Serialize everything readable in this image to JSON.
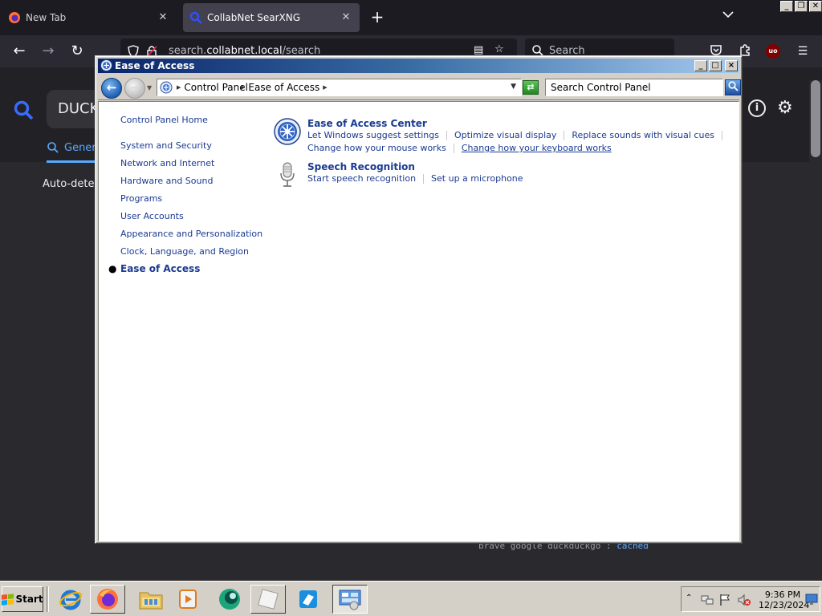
{
  "firefox": {
    "tabs": [
      {
        "label": "New Tab",
        "active": false
      },
      {
        "label": "CollabNet SearXNG",
        "active": true
      }
    ],
    "url_prefix": "search.",
    "url_host": "collabnet.local",
    "url_path": "/search",
    "search_placeholder": "Search",
    "ublock_badge": "uo"
  },
  "searxng": {
    "query": "DUCK",
    "tab_label": "Genera",
    "autodetect_text": "Auto-detect",
    "engines_text": "brave  google  duckduckgo  : ",
    "cached_label": "cached"
  },
  "window": {
    "title": "Ease of Access",
    "breadcrumb": [
      "Control Panel",
      "Ease of Access"
    ],
    "search_placeholder": "Search Control Panel",
    "title_buttons": [
      "_",
      "□",
      "×"
    ]
  },
  "left_nav": {
    "items": [
      {
        "label": "Control Panel Home"
      },
      {
        "label": "System and Security"
      },
      {
        "label": "Network and Internet"
      },
      {
        "label": "Hardware and Sound"
      },
      {
        "label": "Programs"
      },
      {
        "label": "User Accounts"
      },
      {
        "label": "Appearance and Personalization"
      },
      {
        "label": "Clock, Language, and Region"
      },
      {
        "label": "Ease of Access",
        "current": true
      }
    ]
  },
  "categories": [
    {
      "title": "Ease of Access Center",
      "icon": "ease-of-access-icon",
      "links_row1": [
        "Let Windows suggest settings",
        "Optimize visual display",
        "Replace sounds with visual cues"
      ],
      "links_row2": [
        "Change how your mouse works",
        "Change how your keyboard works"
      ]
    },
    {
      "title": "Speech Recognition",
      "icon": "microphone-icon",
      "links_row1": [
        "Start speech recognition",
        "Set up a microphone"
      ]
    }
  ],
  "taskbar": {
    "start_label": "Start",
    "apps": [
      "internet-explorer",
      "firefox",
      "file-explorer",
      "media-player",
      "app-green-circle",
      "app-blank-tile",
      "app-blue-tile",
      "control-panel"
    ],
    "clock_time": "9:36 PM",
    "clock_date": "12/23/2024"
  },
  "colors": {
    "link_blue": "#1b3b92",
    "title_gradient_start": "#0a246a",
    "title_gradient_end": "#a6caf0",
    "firefox_bg": "#1c1b22"
  }
}
